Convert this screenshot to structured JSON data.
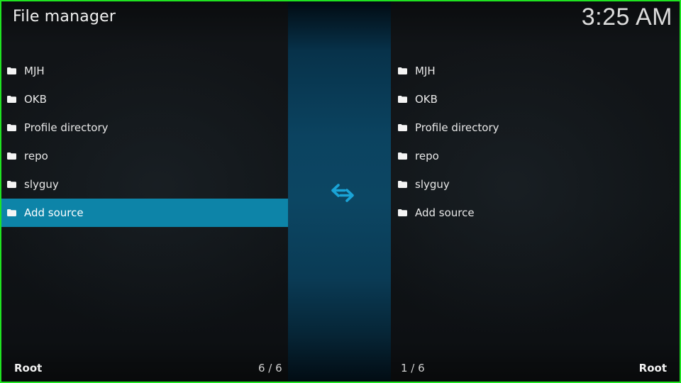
{
  "header": {
    "title": "File manager",
    "clock": "3:25 AM"
  },
  "theme": {
    "accent": "#0d84a8",
    "swap_icon_color": "#1aa3d6",
    "frame_border": "#1fe321"
  },
  "left_pane": {
    "items": [
      {
        "label": "MJH",
        "icon": "folder-icon"
      },
      {
        "label": "OKB",
        "icon": "folder-icon"
      },
      {
        "label": "Profile directory",
        "icon": "folder-icon"
      },
      {
        "label": "repo",
        "icon": "folder-icon"
      },
      {
        "label": "slyguy",
        "icon": "folder-icon"
      },
      {
        "label": "Add source",
        "icon": "folder-icon",
        "selected": true
      }
    ],
    "path": "Root",
    "position": "6 / 6"
  },
  "center": {
    "icon": "swap-arrows-icon"
  },
  "right_pane": {
    "items": [
      {
        "label": "MJH",
        "icon": "folder-icon"
      },
      {
        "label": "OKB",
        "icon": "folder-icon"
      },
      {
        "label": "Profile directory",
        "icon": "folder-icon"
      },
      {
        "label": "repo",
        "icon": "folder-icon"
      },
      {
        "label": "slyguy",
        "icon": "folder-icon"
      },
      {
        "label": "Add source",
        "icon": "folder-icon"
      }
    ],
    "path": "Root",
    "position": "1 / 6"
  }
}
